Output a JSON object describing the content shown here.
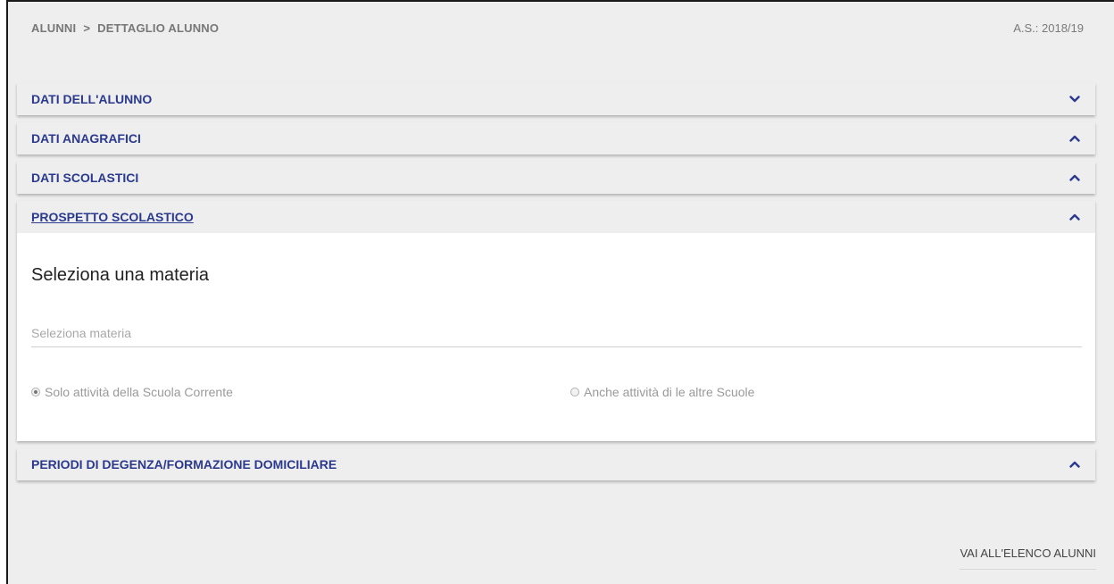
{
  "breadcrumb": {
    "items": [
      "ALUNNI",
      "DETTAGLIO ALUNNO"
    ],
    "separator": ">"
  },
  "header": {
    "school_year": "A.S.: 2018/19"
  },
  "panels": [
    {
      "title": "DATI DELL'ALUNNO",
      "chevron": "chevron-down-icon"
    },
    {
      "title": "DATI ANAGRAFICI",
      "chevron": "chevron-up-icon"
    },
    {
      "title": "DATI SCOLASTICI",
      "chevron": "chevron-up-icon"
    },
    {
      "title": "PROSPETTO SCOLASTICO",
      "chevron": "chevron-up-icon"
    },
    {
      "title": "PERIODI DI DEGENZA/FORMAZIONE DOMICILIARE",
      "chevron": "chevron-up-icon"
    }
  ],
  "prospetto": {
    "heading": "Seleziona una materia",
    "subject_value": "",
    "subject_placeholder": "Seleziona materia",
    "radio_options": [
      {
        "label": "Solo attività della Scuola Corrente",
        "checked": true
      },
      {
        "label": "Anche attività di le altre Scuole",
        "checked": false
      }
    ]
  },
  "footer": {
    "back_link": "VAI ALL'ELENCO ALUNNI"
  },
  "colors": {
    "panel_title": "#2b3a8e",
    "background": "#eeeeee",
    "panel_body": "#ffffff"
  }
}
